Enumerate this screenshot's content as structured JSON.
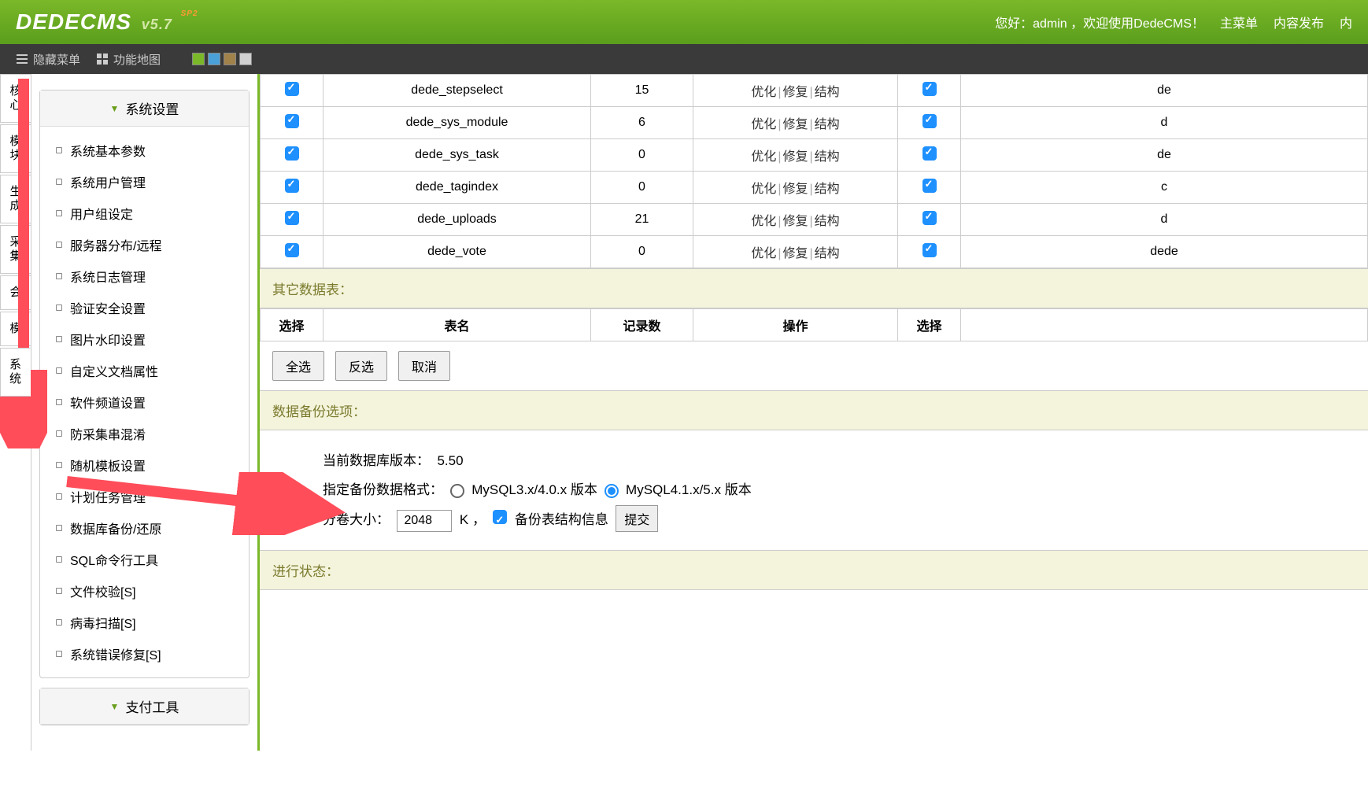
{
  "header": {
    "logo_main": "DEDECMS",
    "logo_ver": "v5.7",
    "logo_sp": "SP2",
    "greeting": "您好：admin ，欢迎使用DedeCMS！",
    "main_menu": "主菜单",
    "content_publish": "内容发布",
    "more": "内"
  },
  "toolbar": {
    "hide_menu": "隐藏菜单",
    "func_map": "功能地图",
    "colors": [
      "#7bb829",
      "#4aa0d8",
      "#a0824a",
      "#d0d0d0"
    ]
  },
  "vtabs": [
    "核心",
    "模块",
    "生成",
    "采集",
    "会",
    "模",
    "系统"
  ],
  "sidebar": {
    "group1_title": "系统设置",
    "group1_items": [
      "系统基本参数",
      "系统用户管理",
      "用户组设定",
      "服务器分布/远程",
      "系统日志管理",
      "验证安全设置",
      "图片水印设置",
      "自定义文档属性",
      "软件频道设置",
      "防采集串混淆",
      "随机模板设置",
      "计划任务管理",
      "数据库备份/还原",
      "SQL命令行工具",
      "文件校验[S]",
      "病毒扫描[S]",
      "系统错误修复[S]"
    ],
    "group2_title": "支付工具"
  },
  "tables": {
    "data_rows": [
      {
        "name": "dede_stepselect",
        "count": "15",
        "t2": "de"
      },
      {
        "name": "dede_sys_module",
        "count": "6",
        "t2": "d"
      },
      {
        "name": "dede_sys_task",
        "count": "0",
        "t2": "de"
      },
      {
        "name": "dede_tagindex",
        "count": "0",
        "t2": "c"
      },
      {
        "name": "dede_uploads",
        "count": "21",
        "t2": "d"
      },
      {
        "name": "dede_vote",
        "count": "0",
        "t2": "dede"
      }
    ],
    "op_optimize": "优化",
    "op_repair": "修复",
    "op_struct": "结构",
    "other_tables_title": "其它数据表：",
    "col_select": "选择",
    "col_name": "表名",
    "col_records": "记录数",
    "col_ops": "操作",
    "btn_selectall": "全选",
    "btn_invert": "反选",
    "btn_cancel": "取消"
  },
  "backup": {
    "section_title": "数据备份选项：",
    "cur_db_ver_label": "当前数据库版本：",
    "cur_db_ver": "5.50",
    "format_label": "指定备份数据格式：",
    "format_opt1": "MySQL3.x/4.0.x 版本",
    "format_opt2": "MySQL4.1.x/5.x 版本",
    "volume_label": "分卷大小：",
    "volume_value": "2048",
    "volume_unit": "K ，",
    "struct_label": "备份表结构信息",
    "submit": "提交",
    "progress_title": "进行状态："
  }
}
